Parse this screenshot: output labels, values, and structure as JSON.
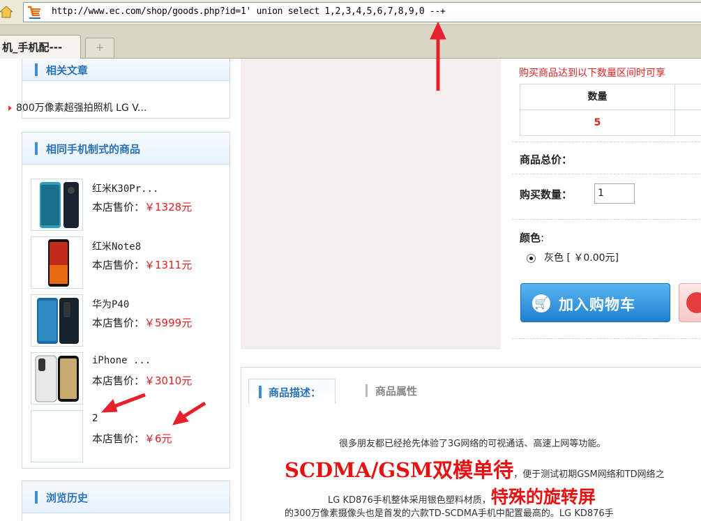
{
  "browser": {
    "url": "http://www.ec.com/shop/goods.php?id=1' union select 1,2,3,4,5,6,7,8,9,0 --+",
    "active_tab": "机_手机配---",
    "new_tab_symbol": "+"
  },
  "sidebar": {
    "related_articles": {
      "title": "相关文章",
      "items": [
        "800万像素超强拍照机 LG V..."
      ]
    },
    "same_standard_goods": {
      "title": "相同手机制式的商品",
      "price_label": "本店售价：",
      "items": [
        {
          "name": "红米K30Pr...",
          "price": "￥1328元"
        },
        {
          "name": "红米Note8",
          "price": "￥1311元"
        },
        {
          "name": "华为P40",
          "price": "￥5999元"
        },
        {
          "name": "iPhone ...",
          "price": "￥3010元"
        },
        {
          "name": "2",
          "price": "￥6元"
        }
      ]
    },
    "history": {
      "title": "浏览历史"
    }
  },
  "product": {
    "volume_note": "购买商品达到以下数量区间时可享",
    "qty_table": {
      "header": "数量",
      "value": "5"
    },
    "total_price_label": "商品总价：",
    "buy_qty_label": "购买数量：",
    "buy_qty_value": "1",
    "color_label": "颜色",
    "color_option": "灰色 [ ￥0.00元]",
    "add_to_cart": "加入购物车"
  },
  "description": {
    "tab_desc": "商品描述：",
    "tab_attr": "商品属性",
    "line1": "很多朋友都已经抢先体验了3G网络的可视通话、高速上网等功能。",
    "line2_big": "SCDMA/GSM双模单待",
    "line2_small": "，便于测试初期GSM网络和TD网络之",
    "line3_small": "LG KD876手机整体采用银色塑料材质，",
    "line3_big": "特殊的旋转屏",
    "line4": "的300万像素摄像头也是首发的六款TD-SCDMA手机中配置最高的。LG KD876手"
  },
  "colors": {
    "accent_blue": "#2a72b5",
    "price_red": "#e02020",
    "annotation_red": "#e8202a"
  }
}
